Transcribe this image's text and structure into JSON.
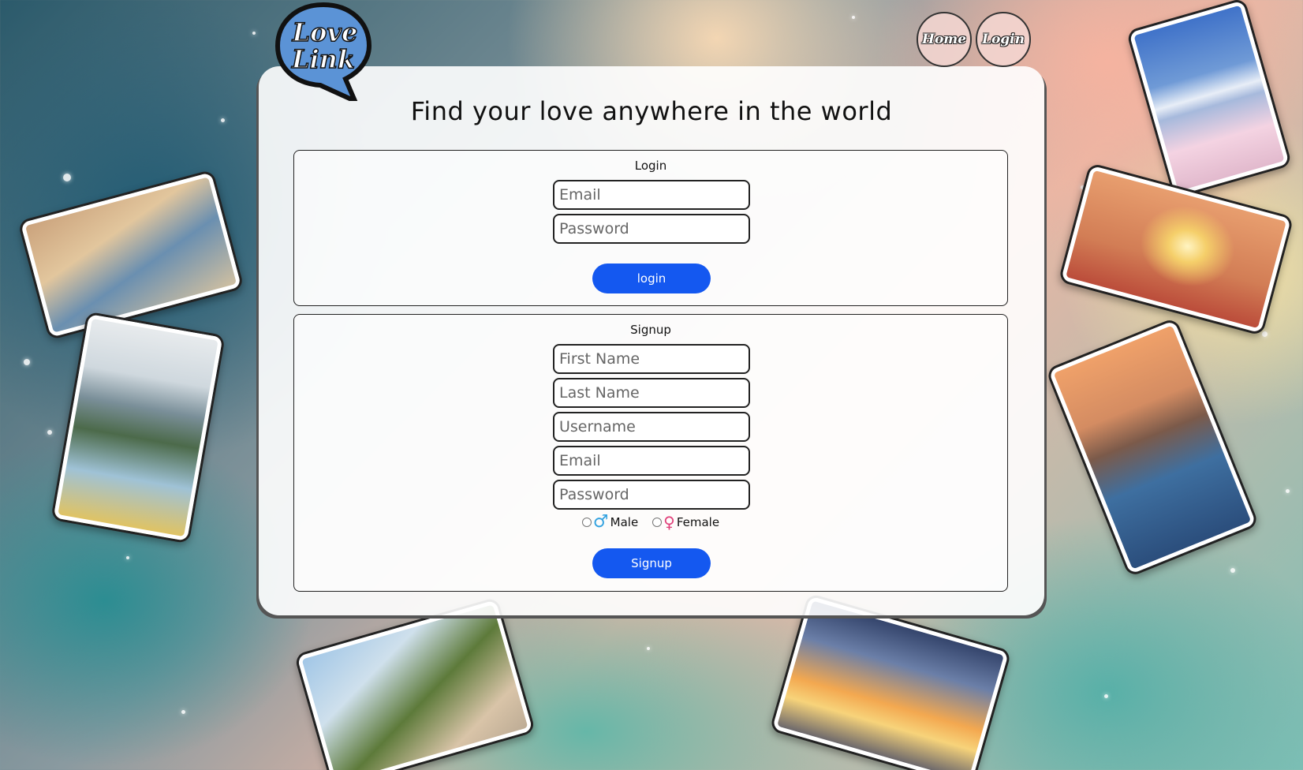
{
  "logo": {
    "line1": "Love",
    "line2": "Link"
  },
  "nav": {
    "home": "Home",
    "login": "Login"
  },
  "heading": "Find your love anywhere in the world",
  "login_form": {
    "title": "Login",
    "email_placeholder": "Email",
    "password_placeholder": "Password",
    "submit": "login"
  },
  "signup_form": {
    "title": "Signup",
    "first_name_placeholder": "First Name",
    "last_name_placeholder": "Last Name",
    "username_placeholder": "Username",
    "email_placeholder": "Email",
    "password_placeholder": "Password",
    "gender_male": "Male",
    "gender_female": "Female",
    "submit": "Signup"
  },
  "photos": [
    {
      "name": "couple-travel-photo",
      "colors": [
        "#c9a07a",
        "#6a8fb0",
        "#d7c3a0"
      ]
    },
    {
      "name": "mountain-lake-photo",
      "colors": [
        "#cfd8de",
        "#4c6a4a",
        "#9fc2d6"
      ]
    },
    {
      "name": "scooter-couple-photo",
      "colors": [
        "#9dc4e6",
        "#5d7a3a",
        "#d9c4a8"
      ]
    },
    {
      "name": "sunset-beach-photo",
      "colors": [
        "#2f3f66",
        "#f3a850",
        "#f7d37a"
      ]
    },
    {
      "name": "mount-fuji-photo",
      "colors": [
        "#3d70c8",
        "#f4d3e2",
        "#e8eef7"
      ]
    },
    {
      "name": "heart-hands-photo",
      "colors": [
        "#e9a070",
        "#f5cf6a",
        "#b94838"
      ]
    },
    {
      "name": "venice-canal-photo",
      "colors": [
        "#f1a26a",
        "#3e6fa0",
        "#2a4c7a"
      ]
    }
  ],
  "colors": {
    "accent": "#1458f0",
    "logo_bubble": "#5b93d6"
  }
}
